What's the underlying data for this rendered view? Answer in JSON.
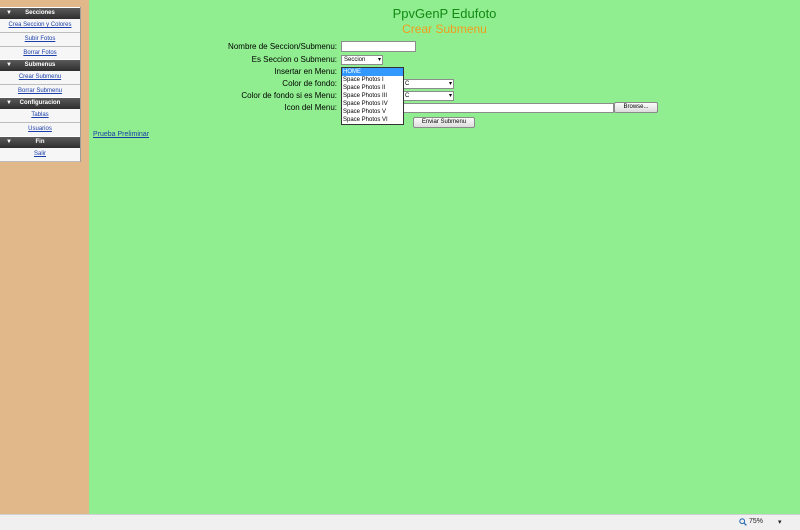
{
  "sidebar": {
    "sections": [
      {
        "title": "Secciones",
        "items": [
          "Crea Seccion y Colores",
          "Subir Fotos",
          "Borrar Fotos"
        ]
      },
      {
        "title": "Submenus",
        "items": [
          "Crear Submenu",
          "Borrar Submenu"
        ]
      },
      {
        "title": "Configuracion",
        "items": [
          "Tablas",
          "Usuarios"
        ]
      },
      {
        "title": "Fin",
        "items": [
          "Salir"
        ]
      }
    ]
  },
  "header": {
    "title": "PpvGenP Edufoto",
    "subtitle": "Crear Submenu"
  },
  "form": {
    "name_label": "Nombre de Seccion/Submenu:",
    "name_value": "",
    "type_label": "Es Seccion o Submenu:",
    "type_value": "Seccion",
    "insert_label": "Insertar en Menu:",
    "insert_value": "HOME",
    "insert_options": [
      "HOME",
      "Space Photos I",
      "Space Photos II",
      "Space Photos III",
      "Space Photos IV",
      "Space Photos V",
      "Space Photos VI"
    ],
    "bg_label": "Color de fondo:",
    "bg_value": "C",
    "bgmenu_label": "Color de fondo si es Menu:",
    "bgmenu_value": "C",
    "icon_label": "Icon del Menu:",
    "browse_label": "Browse...",
    "submit_label": "Enviar Submenu"
  },
  "preview_link": "Prueba Preliminar",
  "statusbar": {
    "zoom": "75%"
  },
  "colors": {
    "main_bg": "#90ee90",
    "sidebar_bg": "#e0b88a",
    "title": "#138a13",
    "subtitle": "#f29d1b"
  },
  "icons": {
    "zoom": "magnifier-icon",
    "section_toggle": "triangle-down-icon"
  }
}
